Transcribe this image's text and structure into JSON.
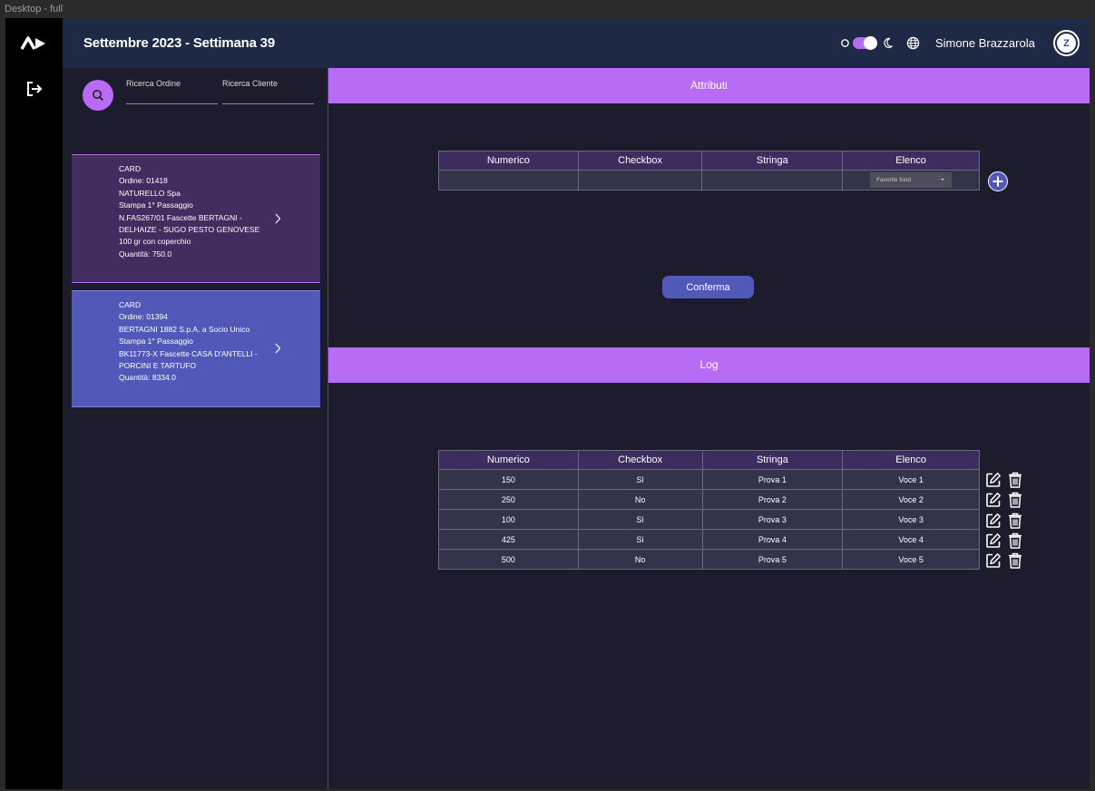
{
  "frame_label": "Desktop - full",
  "header": {
    "title": "Settembre 2023 - Settimana 39",
    "user_name": "Simone Brazzarola",
    "avatar_initials": "Z"
  },
  "search": {
    "order_label": "Ricerca Ordine",
    "client_label": "Ricerca Cliente"
  },
  "cards": [
    {
      "lines": [
        "CARD",
        "Ordine: 01418",
        "NATURELLO Spa",
        "Stampa 1° Passaggio",
        "N.FAS267/01 Fascette BERTAGNI -",
        "DELHAIZE - SUGO PESTO GENOVESE",
        "100 gr con coperchio",
        "Quantità: 750.0"
      ]
    },
    {
      "lines": [
        "CARD",
        "Ordine: 01394",
        "BERTAGNI 1882 S.p.A. a Socio Unico",
        "Stampa 1° Passaggio",
        "BK11773-X Fascette CASA D'ANTELLI -",
        "PORCINI E TARTUFO",
        "Quantità: 8334.0"
      ]
    }
  ],
  "attributes": {
    "title": "Attributi",
    "headers": [
      "Numerico",
      "Checkbox",
      "Stringa",
      "Elenco"
    ],
    "select_value": "Favorite food",
    "confirm_label": "Conferma"
  },
  "log": {
    "title": "Log",
    "headers": [
      "Numerico",
      "Checkbox",
      "Stringa",
      "Elenco"
    ],
    "rows": [
      [
        "150",
        "Sì",
        "Prova 1",
        "Voce 1"
      ],
      [
        "250",
        "No",
        "Prova 2",
        "Voce 2"
      ],
      [
        "100",
        "Sì",
        "Prova 3",
        "Voce 3"
      ],
      [
        "425",
        "Sì",
        "Prova 4",
        "Voce 4"
      ],
      [
        "500",
        "No",
        "Prova 5",
        "Voce 5"
      ]
    ]
  },
  "colors": {
    "accent": "#b86bf5",
    "secondary": "#5158b8",
    "header_bg": "#1e2a45",
    "page_bg": "#1c1c2c"
  },
  "icons": [
    "logo-icon",
    "logout-icon",
    "search-icon",
    "sun-icon",
    "moon-icon",
    "globe-icon",
    "chevron-right-icon",
    "plus-icon",
    "edit-icon",
    "trash-icon"
  ]
}
